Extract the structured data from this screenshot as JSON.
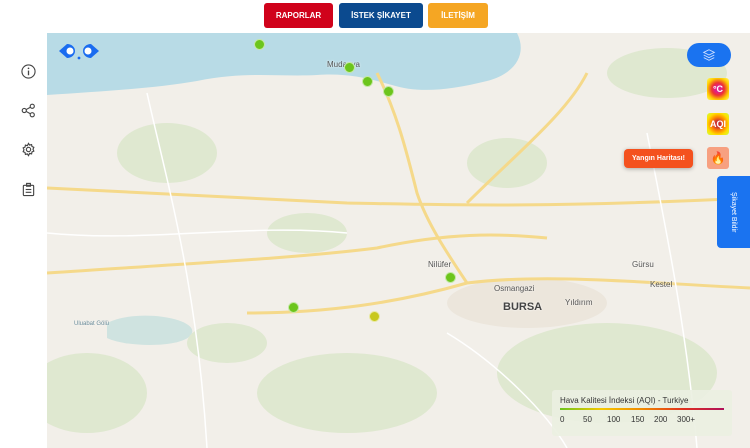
{
  "nav": {
    "reports": "RAPORLAR",
    "complaint": "İSTEK ŞİKAYET",
    "contact": "İLETİŞİM"
  },
  "map": {
    "labels": {
      "mudanya": "Mudanya",
      "nilufer": "Nilüfer",
      "osmangazi": "Osmangazi",
      "bursa": "BURSA",
      "yildirim": "Yıldırım",
      "gursu": "Gürsu",
      "kestel": "Kestel",
      "uluabat": "Uluabat Gölü"
    },
    "temp_layer": "°C",
    "aqi_layer": "AQI",
    "fire_tooltip": "Yangın Haritası!",
    "report_tab": "Şikayet Bildir",
    "stations": [
      {
        "aqi": "good",
        "color": "#6cc51c"
      },
      {
        "aqi": "good",
        "color": "#6cc51c"
      },
      {
        "aqi": "good",
        "color": "#6cc51c"
      },
      {
        "aqi": "good",
        "color": "#6cc51c"
      },
      {
        "aqi": "good",
        "color": "#6cc51c"
      },
      {
        "aqi": "good",
        "color": "#6cc51c"
      },
      {
        "aqi": "moderate",
        "color": "#c8c81c"
      }
    ]
  },
  "legend": {
    "title": "Hava Kalitesi İndeksi (AQI) - Turkiye",
    "ticks": [
      "0",
      "50",
      "100",
      "150",
      "200",
      "300+"
    ]
  }
}
